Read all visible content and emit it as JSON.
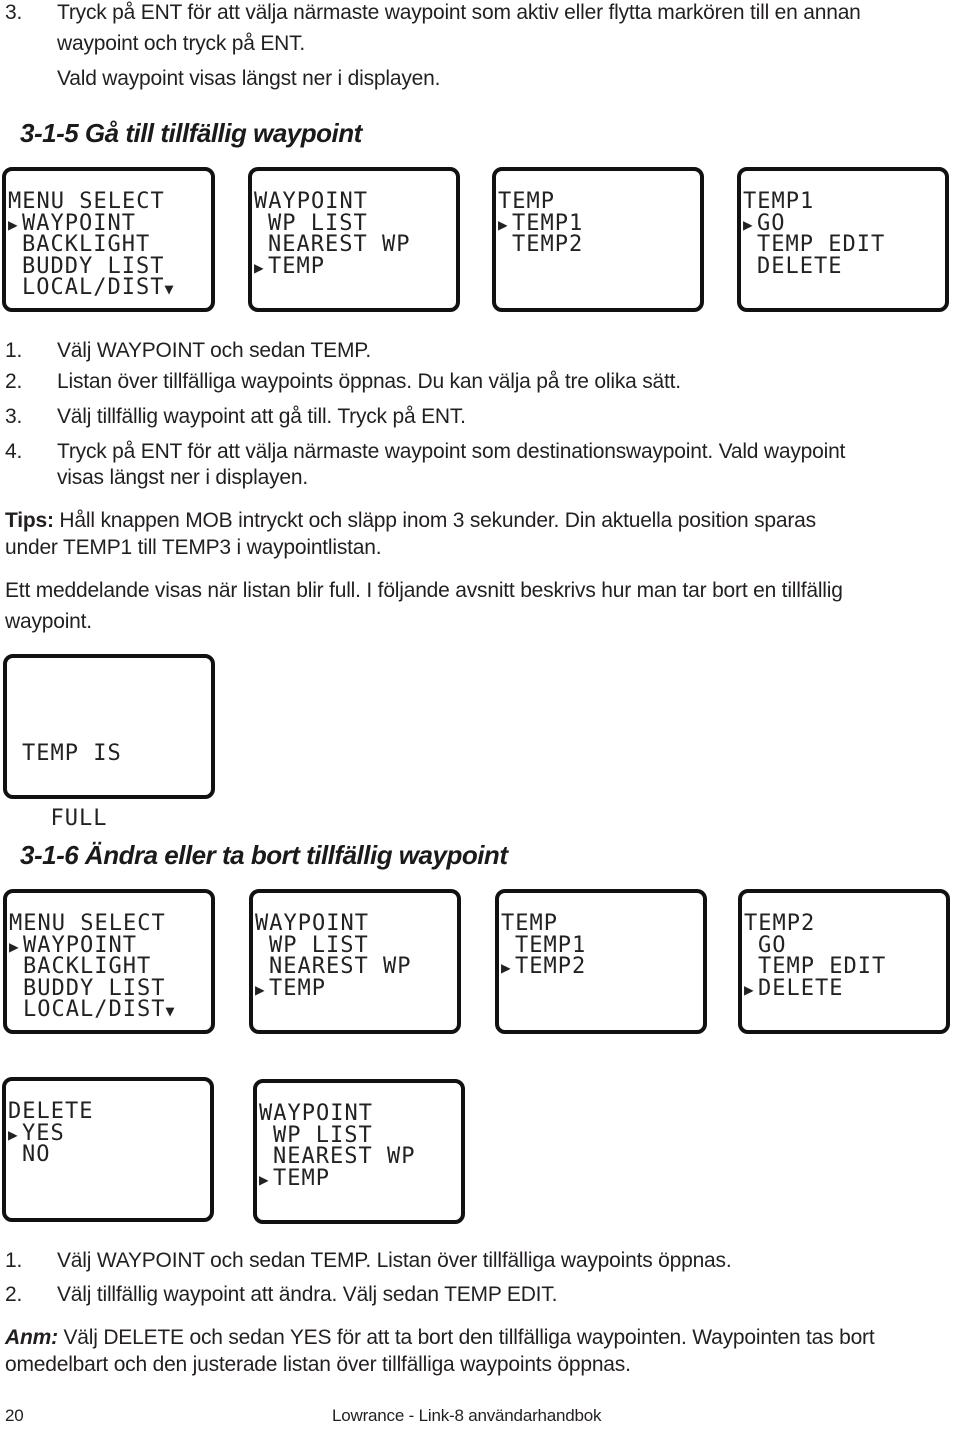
{
  "intro": {
    "step3_number": "3.",
    "step3_line1": "Tryck på ENT för att välja närmaste waypoint som aktiv eller flytta markören till en annan",
    "step3_line2": "waypoint och tryck på ENT.",
    "step3_line3": "Vald waypoint visas längst ner i displayen."
  },
  "section_315": {
    "heading": "3-1-5 Gå till tillfällig waypoint",
    "screens": [
      {
        "title": "MENU SELECT",
        "items": [
          {
            "label": "WAYPOINT",
            "selected": true
          },
          {
            "label": "BACKLIGHT",
            "selected": false
          },
          {
            "label": "BUDDY LIST",
            "selected": false
          },
          {
            "label": "LOCAL/DIST",
            "selected": false,
            "more": "▼"
          }
        ]
      },
      {
        "title": "WAYPOINT",
        "items": [
          {
            "label": "WP LIST",
            "selected": false
          },
          {
            "label": "NEAREST WP",
            "selected": false
          },
          {
            "label": "TEMP",
            "selected": true
          }
        ]
      },
      {
        "title": "TEMP",
        "items": [
          {
            "label": "TEMP1",
            "selected": true
          },
          {
            "label": "TEMP2",
            "selected": false
          }
        ]
      },
      {
        "title": "TEMP1",
        "items": [
          {
            "label": "GO",
            "selected": true
          },
          {
            "label": "TEMP EDIT",
            "selected": false
          },
          {
            "label": "DELETE",
            "selected": false
          }
        ]
      }
    ],
    "steps": [
      {
        "num": "1.",
        "text": "Välj WAYPOINT och sedan TEMP."
      },
      {
        "num": "2.",
        "text": "Listan över tillfälliga waypoints öppnas. Du kan välja på tre olika sätt."
      },
      {
        "num": "3.",
        "text": "Välj tillfällig waypoint att gå till. Tryck på ENT."
      },
      {
        "num": "4.",
        "text": "Tryck på ENT för att välja närmaste waypoint som destinationswaypoint. Vald waypoint",
        "text2": "visas längst ner i displayen."
      }
    ],
    "tip_label": "Tips:",
    "tip_text1": " Håll knappen MOB intryckt och släpp inom 3 sekunder. Din aktuella position sparas",
    "tip_text2": "under TEMP1 till TEMP3 i waypointlistan.",
    "note_line1": "Ett meddelande visas när listan blir full. I följande avsnitt beskrivs hur man tar bort en tillfällig",
    "note_line2": "waypoint.",
    "full_screen": {
      "line1": "TEMP IS",
      "line2": "  FULL"
    }
  },
  "section_316": {
    "heading": "3-1-6 Ändra eller ta bort tillfällig waypoint",
    "screens": [
      {
        "title": "MENU SELECT",
        "items": [
          {
            "label": "WAYPOINT",
            "selected": true
          },
          {
            "label": "BACKLIGHT",
            "selected": false
          },
          {
            "label": "BUDDY LIST",
            "selected": false
          },
          {
            "label": "LOCAL/DIST",
            "selected": false,
            "more": "▼"
          }
        ]
      },
      {
        "title": "WAYPOINT",
        "items": [
          {
            "label": "WP LIST",
            "selected": false
          },
          {
            "label": "NEAREST WP",
            "selected": false
          },
          {
            "label": "TEMP",
            "selected": true
          }
        ]
      },
      {
        "title": "TEMP",
        "items": [
          {
            "label": "TEMP1",
            "selected": false
          },
          {
            "label": "TEMP2",
            "selected": true
          }
        ]
      },
      {
        "title": "TEMP2",
        "items": [
          {
            "label": "GO",
            "selected": false
          },
          {
            "label": "TEMP EDIT",
            "selected": false
          },
          {
            "label": "DELETE",
            "selected": true
          }
        ]
      },
      {
        "title": "DELETE",
        "items": [
          {
            "label": "YES",
            "selected": true
          },
          {
            "label": "NO",
            "selected": false
          }
        ]
      },
      {
        "title": "WAYPOINT",
        "items": [
          {
            "label": "WP LIST",
            "selected": false
          },
          {
            "label": "NEAREST WP",
            "selected": false
          },
          {
            "label": "TEMP",
            "selected": true
          }
        ]
      }
    ],
    "steps": [
      {
        "num": "1.",
        "text": "Välj WAYPOINT och sedan TEMP. Listan över tillfälliga waypoints öppnas."
      },
      {
        "num": "2.",
        "text": "Välj tillfällig waypoint att ändra. Välj sedan TEMP EDIT."
      }
    ],
    "note_label": "Anm:",
    "note_text1": " Välj DELETE och sedan YES för att ta bort den tillfälliga waypointen. Waypointen tas bort",
    "note_text2": "omedelbart och den justerade listan över tillfälliga waypoints öppnas."
  },
  "footer": {
    "page_number": "20",
    "title": "Lowrance - Link-8 användarhandbok"
  },
  "icons": {
    "cursor": "▶",
    "scroll_down": "▼"
  }
}
